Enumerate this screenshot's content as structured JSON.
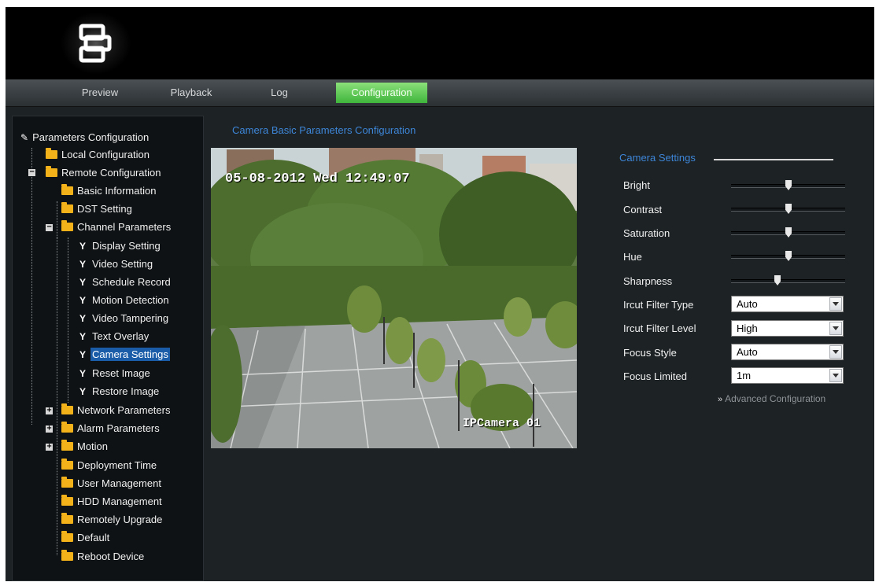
{
  "nav": {
    "tabs": [
      {
        "label": "Preview"
      },
      {
        "label": "Playback"
      },
      {
        "label": "Log"
      },
      {
        "label": "Configuration",
        "active": true
      }
    ]
  },
  "sidebar": {
    "root": "Parameters Configuration",
    "items": [
      {
        "label": "Local Configuration"
      },
      {
        "label": "Remote Configuration"
      },
      {
        "label": "Basic Information"
      },
      {
        "label": "DST Setting"
      },
      {
        "label": "Channel Parameters"
      },
      {
        "label": "Display Setting"
      },
      {
        "label": "Video Setting"
      },
      {
        "label": "Schedule Record"
      },
      {
        "label": "Motion Detection"
      },
      {
        "label": "Video Tampering"
      },
      {
        "label": "Text Overlay"
      },
      {
        "label": "Camera Settings",
        "selected": true
      },
      {
        "label": "Reset Image"
      },
      {
        "label": "Restore Image"
      },
      {
        "label": "Network Parameters"
      },
      {
        "label": "Alarm Parameters"
      },
      {
        "label": "Motion"
      },
      {
        "label": "Deployment Time"
      },
      {
        "label": "User Management"
      },
      {
        "label": "HDD Management"
      },
      {
        "label": "Remotely Upgrade"
      },
      {
        "label": "Default"
      },
      {
        "label": "Reboot Device"
      }
    ]
  },
  "main": {
    "title": "Camera Basic Parameters Configuration",
    "video": {
      "timestamp": "05-08-2012 Wed 12:49:07",
      "camera_name": "IPCamera 01"
    }
  },
  "settings": {
    "heading": "Camera Settings",
    "sliders": [
      {
        "label": "Bright",
        "value": 0.5
      },
      {
        "label": "Contrast",
        "value": 0.5
      },
      {
        "label": "Saturation",
        "value": 0.5
      },
      {
        "label": "Hue",
        "value": 0.5
      },
      {
        "label": "Sharpness",
        "value": 0.4
      }
    ],
    "selects": [
      {
        "label": "Ircut Filter Type",
        "value": "Auto"
      },
      {
        "label": "Ircut Filter Level",
        "value": "High"
      },
      {
        "label": "Focus Style",
        "value": "Auto"
      },
      {
        "label": "Focus Limited",
        "value": "1m"
      }
    ],
    "advanced_link": "Advanced Configuration"
  },
  "colors": {
    "accent_blue": "#3d86d8",
    "active_tab_green": "#4cc446",
    "folder_yellow": "#f3b21a",
    "selection_blue": "#1a5ca8"
  }
}
